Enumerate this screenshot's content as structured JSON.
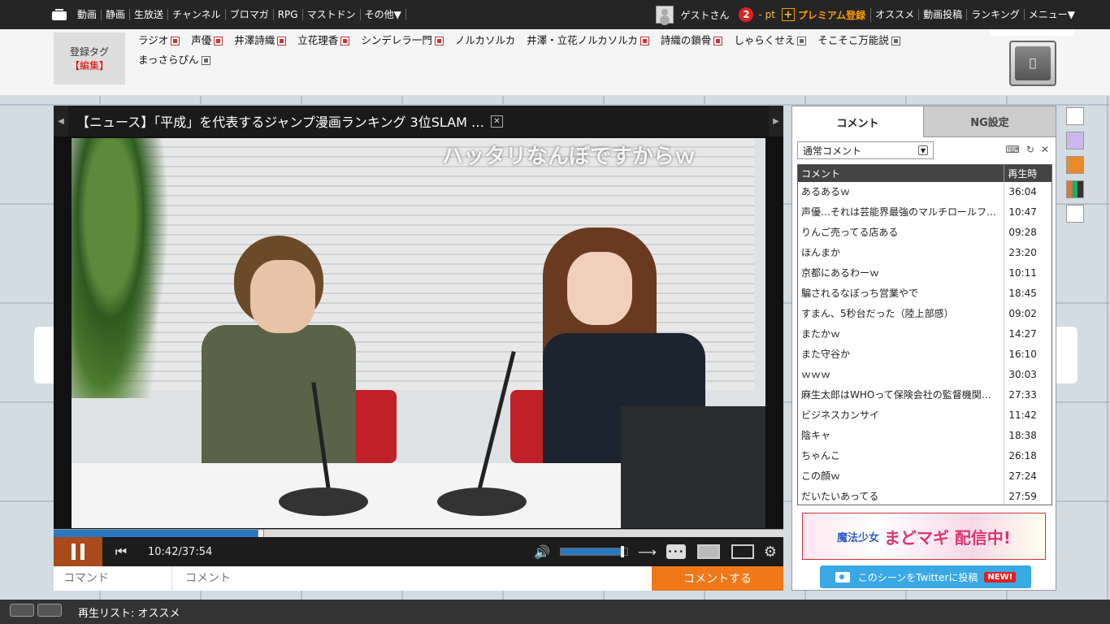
{
  "nav": {
    "links": [
      "動画",
      "静画",
      "生放送",
      "チャンネル",
      "ブロマガ",
      "RPG",
      "マストドン",
      "その他▼"
    ],
    "user": "ゲストさん",
    "notif_count": "2",
    "points": "- pt",
    "premium": "プレミアム登録",
    "right_links": [
      "オススメ",
      "動画投稿",
      "ランキング",
      "メニュー▼"
    ]
  },
  "tags": {
    "box_label": "登録タグ",
    "box_edit": "【編集】",
    "items": [
      "ラジオ",
      "声優",
      "井澤詩織",
      "立花理香",
      "シンデレラ一門",
      "ノルカソルカ",
      "井澤・立花ノルカソルカ",
      "詩織の鎖骨",
      "しゃらくせえ",
      "そこそこ万能説",
      "まっさらぴん"
    ]
  },
  "player": {
    "title": "【ニュース】「平成」を代表するジャンプ漫画ランキング 3位SLAM …",
    "danmaku": "ハッタリなんぼですからｗ",
    "time": "10:42/37:54",
    "progress": 0.284,
    "volume": 0.95,
    "command_placeholder": "コマンド",
    "comment_placeholder": "コメント",
    "submit": "コメントする"
  },
  "comments_panel": {
    "tab_comment": "コメント",
    "tab_ng": "NG設定",
    "select": "通常コメント",
    "col_comment": "コメント",
    "col_time": "再生時",
    "rows": [
      {
        "text": "あるあるｗ",
        "time": "36:04"
      },
      {
        "text": "声優…それは芸能界最強のマルチロールファ…",
        "time": "10:47"
      },
      {
        "text": "りんご売ってる店ある",
        "time": "09:28"
      },
      {
        "text": "ほんまか",
        "time": "23:20"
      },
      {
        "text": "京都にあるわーｗ",
        "time": "10:11"
      },
      {
        "text": "騙されるなぼっち営業やで",
        "time": "18:45"
      },
      {
        "text": "すまん、5秒台だった（陸上部感）",
        "time": "09:02"
      },
      {
        "text": "またかｗ",
        "time": "14:27"
      },
      {
        "text": "また守谷か",
        "time": "16:10"
      },
      {
        "text": "ｗｗｗ",
        "time": "30:03"
      },
      {
        "text": "麻生太郎はWHOって保険会社の監督機関と…",
        "time": "27:33"
      },
      {
        "text": "ビジネスカンサイ",
        "time": "11:42"
      },
      {
        "text": "陰キャ",
        "time": "18:38"
      },
      {
        "text": "ちゃんこ",
        "time": "26:18"
      },
      {
        "text": "この顔ｗ",
        "time": "27:24"
      },
      {
        "text": "だいたいあってる",
        "time": "27:59"
      }
    ],
    "ad_title": "魔法少女",
    "ad_text": "まどマギ 配信中!",
    "twitter_btn": "このシーンをTwitterに投稿",
    "twitter_new": "NEW!"
  },
  "bottom": {
    "playlist": "再生リスト: オススメ"
  }
}
